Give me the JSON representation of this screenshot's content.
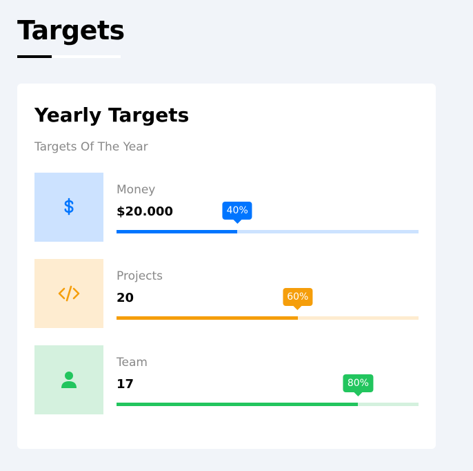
{
  "page": {
    "title": "Targets"
  },
  "card": {
    "title": "Yearly Targets",
    "subtitle": "Targets Of The Year"
  },
  "targets": [
    {
      "label": "Money",
      "value": "$20.000",
      "percent_label": "40%",
      "progress": 0.4,
      "icon": "dollar-icon",
      "color": "#0075ff",
      "icon_bg": "#cce2ff",
      "track_color": "#cce2ff"
    },
    {
      "label": "Projects",
      "value": "20",
      "percent_label": "60%",
      "progress": 0.6,
      "icon": "code-icon",
      "color": "#f59e0b",
      "icon_bg": "#feecd0",
      "track_color": "#feecd0"
    },
    {
      "label": "Team",
      "value": "17",
      "percent_label": "80%",
      "progress": 0.8,
      "icon": "user-icon",
      "color": "#22c55e",
      "icon_bg": "#d4f1de",
      "track_color": "#d4f1de"
    }
  ]
}
